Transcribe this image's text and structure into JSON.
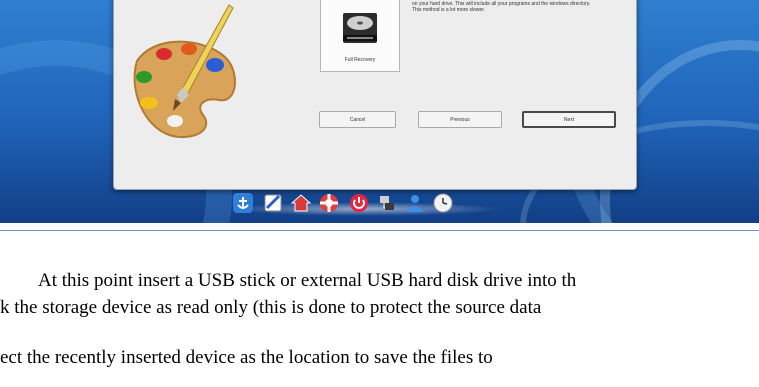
{
  "wizard": {
    "recovery_option_label": "Full Recovery",
    "description": "on your hard drive. This will include all your programs and the windows directory. This method is a lot more slower.",
    "buttons": {
      "cancel": "Cancel",
      "previous": "Previous",
      "next": "Next"
    }
  },
  "dock": {
    "icons": [
      "anchor-icon",
      "notepad-icon",
      "home-icon",
      "lifebuoy-icon",
      "power-icon",
      "network-icon",
      "user-icon",
      "clock-icon"
    ]
  },
  "article": {
    "line1": "At this point insert a USB stick or external USB hard disk drive into th",
    "line2": "k the storage device as read only (this is done to protect the source data",
    "line3": "ect the recently inserted device as the location to save the files to"
  },
  "colors": {
    "desktop_blue": "#1f63b8",
    "divider": "#6a8fd0",
    "dialog_bg": "#ededed"
  }
}
